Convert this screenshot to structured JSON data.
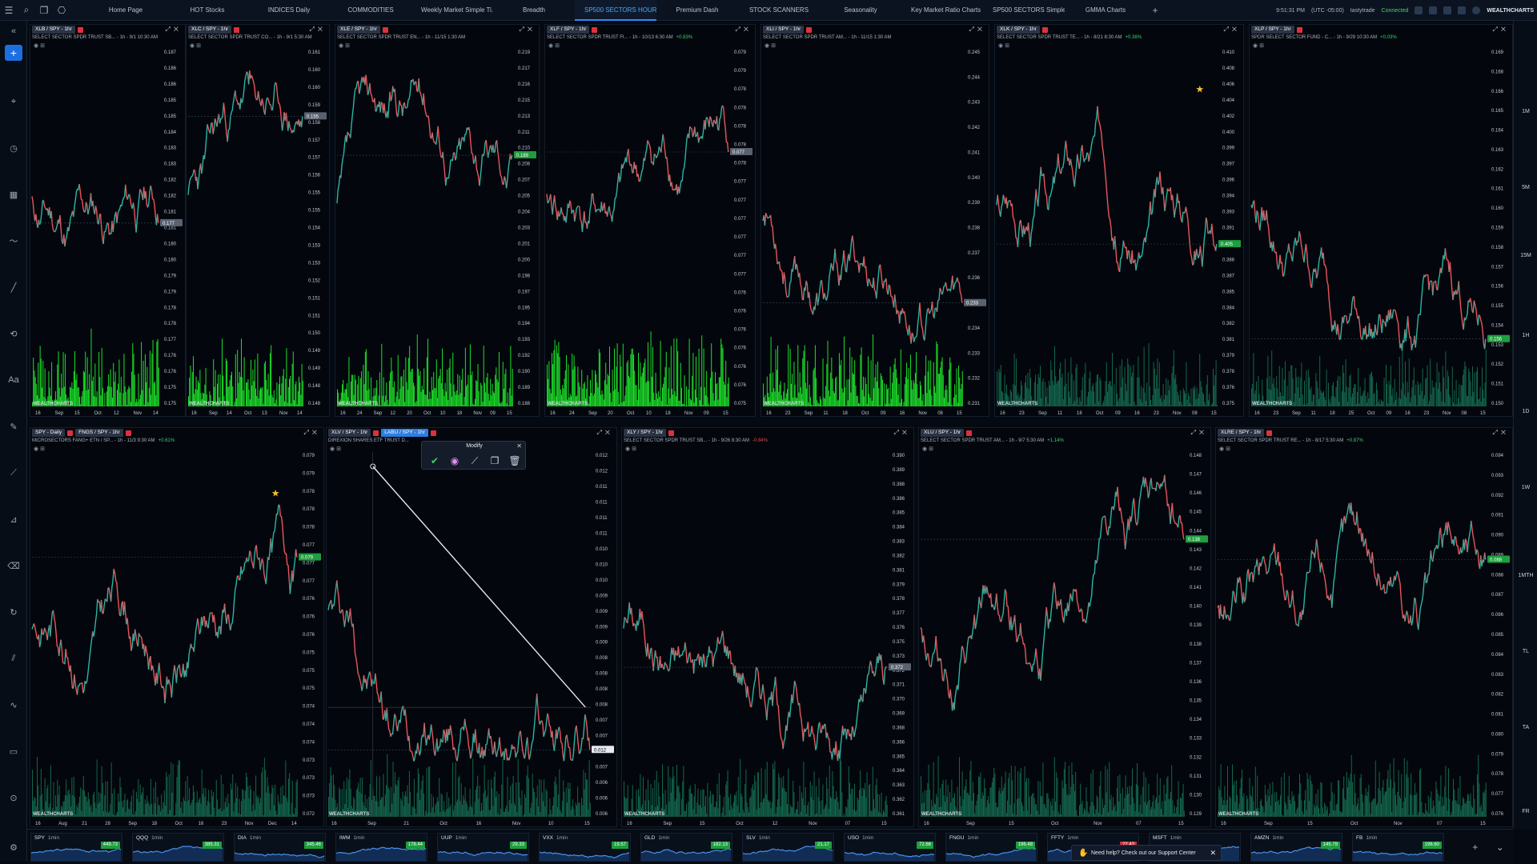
{
  "tabs": [
    "Home Page",
    "HOT Stocks",
    "INDICES Daily",
    "COMMODITIES",
    "Weekly Market Simple Ti...",
    "Breadth",
    "SP500 SECTORS HOURLY",
    "Premium Dash",
    "STOCK SCANNERS",
    "Seasonality",
    "Key Market Ratio Charts",
    "SP500 SECTORS Simple ...",
    "GMMA Charts"
  ],
  "active_tab": "SP500 SECTORS HOURLY",
  "topright": {
    "time": "9:51:31 PM",
    "tz": "(UTC -05:00)",
    "broker": "tastytrade",
    "status": "Connected",
    "brand": "WEALTHCHARTS"
  },
  "right_timeframes": [
    "1M",
    "5M",
    "15M",
    "1H",
    "1D",
    "1W",
    "1MTH",
    "TL",
    "TA",
    "FR"
  ],
  "modify": {
    "title": "Modify"
  },
  "panels": [
    {
      "id": "p1",
      "sym": "XLB / SPY - 1hr",
      "desc": "SELECT SECTOR SPDR TRUST SB... - 1h - 9/1 10:30 AM",
      "chg": "",
      "chgc": "",
      "ticks": [
        "0.187",
        "0.186",
        "0.186",
        "0.185",
        "0.185",
        "0.184",
        "0.183",
        "0.183",
        "0.182",
        "0.182",
        "0.181",
        "0.181",
        "0.180",
        "0.180",
        "0.179",
        "0.179",
        "0.178",
        "0.178",
        "0.177",
        "0.176",
        "0.176",
        "0.175",
        "0.175"
      ],
      "last": "0.177",
      "lastc": "#5a6270",
      "xt": [
        "16",
        "Sep",
        "15",
        "Oct",
        "12",
        "Nov",
        "14"
      ],
      "seed": 11,
      "trend": -0.3,
      "star": null
    },
    {
      "id": "p2",
      "sym": "XLC / SPY - 1hr",
      "desc": "SELECT SECTOR SPDR TRUST CO... - 1h - 9/1 5:30 AM",
      "chg": "",
      "chgc": "",
      "ticks": [
        "0.161",
        "0.160",
        "0.160",
        "0.159",
        "0.158",
        "0.157",
        "0.157",
        "0.156",
        "0.155",
        "0.155",
        "0.154",
        "0.153",
        "0.153",
        "0.152",
        "0.151",
        "0.151",
        "0.150",
        "0.149",
        "0.149",
        "0.148",
        "0.148"
      ],
      "last": "0.155",
      "lastc": "#5a6270",
      "xt": [
        "16",
        "Sep",
        "14",
        "Oct",
        "13",
        "Nov",
        "14"
      ],
      "seed": 23,
      "trend": 0.4,
      "star": null
    },
    {
      "id": "p3",
      "sym": "XLE / SPY - 1hr",
      "desc": "SELECT SECTOR SPDR TRUST EN... - 1h - 11/15 1:30 AM",
      "chg": "",
      "chgc": "",
      "ticks": [
        "0.219",
        "0.217",
        "0.216",
        "0.215",
        "0.213",
        "0.211",
        "0.210",
        "0.208",
        "0.207",
        "0.205",
        "0.204",
        "0.203",
        "0.201",
        "0.200",
        "0.198",
        "0.197",
        "0.195",
        "0.194",
        "0.193",
        "0.192",
        "0.190",
        "0.189",
        "0.188"
      ],
      "last": "0.189",
      "lastc": "#1e9e3e",
      "xt": [
        "16",
        "24",
        "Sep",
        "12",
        "20",
        "Oct",
        "10",
        "18",
        "Nov",
        "09",
        "15"
      ],
      "seed": 37,
      "trend": 0.1,
      "star": null
    },
    {
      "id": "p4",
      "sym": "XLF / SPY - 1hr",
      "desc": "SELECT SECTOR SPDR TRUST FI... - 1h - 10/13 6:30 AM",
      "chg": "+0.83%",
      "chgc": "g",
      "ticks": [
        "0.079",
        "0.079",
        "0.078",
        "0.078",
        "0.078",
        "0.078",
        "0.078",
        "0.077",
        "0.077",
        "0.077",
        "0.077",
        "0.077",
        "0.077",
        "0.076",
        "0.076",
        "0.076",
        "0.076",
        "0.076",
        "0.076",
        "0.075"
      ],
      "last": "0.077",
      "lastc": "#5a6270",
      "xt": [
        "16",
        "24",
        "Sep",
        "20",
        "Oct",
        "10",
        "18",
        "Nov",
        "09",
        "15"
      ],
      "seed": 41,
      "trend": 0.0,
      "star": null
    },
    {
      "id": "p5",
      "sym": "XLI / SPY - 1hr",
      "desc": "SELECT SECTOR SPDR TRUST AM... - 1h - 11/15 1:30 AM",
      "chg": "",
      "chgc": "",
      "ticks": [
        "0.245",
        "0.244",
        "0.243",
        "0.242",
        "0.241",
        "0.240",
        "0.239",
        "0.238",
        "0.237",
        "0.236",
        "0.235",
        "0.234",
        "0.233",
        "0.232",
        "0.231"
      ],
      "last": "0.233",
      "lastc": "#5a6270",
      "xt": [
        "16",
        "23",
        "Sep",
        "11",
        "18",
        "Oct",
        "09",
        "16",
        "Nov",
        "08",
        "15"
      ],
      "seed": 53,
      "trend": -0.35,
      "star": null
    },
    {
      "id": "p6",
      "sym": "XLK / SPY - 1hr",
      "desc": "SELECT SECTOR SPDR TRUST TE... - 1h - 8/21 8:30 AM",
      "chg": "+0.38%",
      "chgc": "g",
      "ticks": [
        "0.410",
        "0.408",
        "0.406",
        "0.404",
        "0.402",
        "0.400",
        "0.399",
        "0.397",
        "0.396",
        "0.394",
        "0.393",
        "0.391",
        "0.390",
        "0.388",
        "0.387",
        "0.385",
        "0.384",
        "0.382",
        "0.381",
        "0.379",
        "0.378",
        "0.376",
        "0.375"
      ],
      "last": "0.405",
      "lastc": "#1e9e3e",
      "xt": [
        "16",
        "23",
        "Sep",
        "11",
        "18",
        "Oct",
        "09",
        "16",
        "23",
        "Nov",
        "08",
        "15"
      ],
      "seed": 67,
      "trend": 0.55,
      "star": [
        0.9,
        0.1
      ]
    },
    {
      "id": "p7",
      "sym": "XLP / SPY - 1hr",
      "desc": "SPDR SELECT SECTOR FUND - C... - 1h - 9/29 10:30 AM",
      "chg": "+0.03%",
      "chgc": "g",
      "ticks": [
        "0.169",
        "0.168",
        "0.166",
        "0.165",
        "0.164",
        "0.163",
        "0.162",
        "0.161",
        "0.160",
        "0.159",
        "0.158",
        "0.157",
        "0.156",
        "0.155",
        "0.154",
        "0.153",
        "0.152",
        "0.151",
        "0.150"
      ],
      "last": "0.156",
      "lastc": "#1e9e3e",
      "xt": [
        "16",
        "23",
        "Sep",
        "11",
        "18",
        "25",
        "Oct",
        "09",
        "16",
        "23",
        "Nov",
        "08",
        "15"
      ],
      "seed": 79,
      "trend": -0.4,
      "star": null
    },
    {
      "id": "p8",
      "sym": "SPY - Daily",
      "sym2": "FNGS / SPY - 1hr",
      "desc": "MICROSECTORS FANG+ ETN / SP... - 1h - 11/3 9:30 AM",
      "chg": "+0.61%",
      "chgc": "g",
      "ticks": [
        "0.079",
        "0.079",
        "0.078",
        "0.078",
        "0.078",
        "0.077",
        "0.077",
        "0.077",
        "0.076",
        "0.076",
        "0.076",
        "0.075",
        "0.075",
        "0.075",
        "0.074",
        "0.074",
        "0.074",
        "0.073",
        "0.073",
        "0.073",
        "0.072"
      ],
      "last": "0.079",
      "lastc": "#1e9e3e",
      "xt": [
        "16",
        "Aug",
        "21",
        "28",
        "Sep",
        "18",
        "Oct",
        "16",
        "23",
        "Nov",
        "Dec",
        "14"
      ],
      "seed": 83,
      "trend": 0.6,
      "star": [
        0.9,
        0.1
      ]
    },
    {
      "id": "p9",
      "sym": "XLV / SPY - 1hr",
      "sym2": "LABU / SPY - 1hr",
      "desc": "DIREXION SHARES ETF TRUST D...",
      "chg": "",
      "chgc": "",
      "ticks": [
        "0.012",
        "0.012",
        "0.011",
        "0.011",
        "0.011",
        "0.011",
        "0.010",
        "0.010",
        "0.010",
        "0.009",
        "0.009",
        "0.009",
        "0.009",
        "0.008",
        "0.008",
        "0.008",
        "0.008",
        "0.007",
        "0.007",
        "0.007",
        "0.007",
        "0.006",
        "0.006",
        "0.006"
      ],
      "last": "0.012",
      "lastc": "#e6eaf0",
      "xt": [
        "16",
        "Sep",
        "21",
        "Oct",
        "16",
        "Nov",
        "10",
        "15"
      ],
      "seed": 97,
      "trend": -0.7,
      "star": null,
      "trendline": true
    },
    {
      "id": "p10",
      "sym": "XLY / SPY - 1hr",
      "desc": "SELECT SECTOR SPDR TRUST SB... - 1h - 9/26 8:30 AM",
      "chg": "-0.84%",
      "chgc": "r",
      "ticks": [
        "0.390",
        "0.389",
        "0.388",
        "0.386",
        "0.385",
        "0.384",
        "0.383",
        "0.382",
        "0.381",
        "0.379",
        "0.378",
        "0.377",
        "0.376",
        "0.375",
        "0.373",
        "0.372",
        "0.371",
        "0.370",
        "0.369",
        "0.368",
        "0.366",
        "0.365",
        "0.364",
        "0.363",
        "0.362",
        "0.361"
      ],
      "last": "0.372",
      "lastc": "#5a6270",
      "xt": [
        "16",
        "Sep",
        "15",
        "Oct",
        "12",
        "Nov",
        "07",
        "15"
      ],
      "seed": 101,
      "trend": -0.1,
      "star": null
    },
    {
      "id": "p11",
      "sym": "XLU / SPY - 1hr",
      "desc": "SELECT SECTOR SPDR TRUST AM... - 1h - 9/7 5:30 AM",
      "chg": "+1.14%",
      "chgc": "g",
      "ticks": [
        "0.148",
        "0.147",
        "0.146",
        "0.145",
        "0.144",
        "0.143",
        "0.142",
        "0.141",
        "0.140",
        "0.139",
        "0.138",
        "0.137",
        "0.136",
        "0.135",
        "0.134",
        "0.133",
        "0.132",
        "0.131",
        "0.130",
        "0.129"
      ],
      "last": "0.138",
      "lastc": "#1e9e3e",
      "xt": [
        "16",
        "Sep",
        "15",
        "Oct",
        "Nov",
        "07",
        "15"
      ],
      "seed": 113,
      "trend": -0.05,
      "star": null
    },
    {
      "id": "p12",
      "sym": "XLRE / SPY - 1hr",
      "desc": "SELECT SECTOR SPDR TRUST RE... - 1h - 8/17 5:30 AM",
      "chg": "+0.87%",
      "chgc": "g",
      "ticks": [
        "0.094",
        "0.093",
        "0.092",
        "0.091",
        "0.090",
        "0.089",
        "0.088",
        "0.087",
        "0.086",
        "0.085",
        "0.084",
        "0.083",
        "0.082",
        "0.081",
        "0.080",
        "0.079",
        "0.078",
        "0.077",
        "0.076"
      ],
      "last": "0.088",
      "lastc": "#1e9e3e",
      "xt": [
        "16",
        "Sep",
        "15",
        "Oct",
        "Nov",
        "07",
        "15"
      ],
      "seed": 127,
      "trend": -0.2,
      "star": null
    }
  ],
  "minis": [
    {
      "sym": "SPY",
      "tf": "1min",
      "price": "449.73",
      "c": "g",
      "seed": 3
    },
    {
      "sym": "QQQ",
      "tf": "1min",
      "price": "385.31",
      "c": "g",
      "seed": 5
    },
    {
      "sym": "DIA",
      "tf": "1min",
      "price": "345.46",
      "c": "g",
      "seed": 7
    },
    {
      "sym": "IWM",
      "tf": "1min",
      "price": "178.44",
      "c": "g",
      "seed": 9
    },
    {
      "sym": "UUP",
      "tf": "1min",
      "price": "29.33",
      "c": "g",
      "seed": 13
    },
    {
      "sym": "VXX",
      "tf": "1min",
      "price": "19.57",
      "c": "g",
      "seed": 17
    },
    {
      "sym": "GLD",
      "tf": "1min",
      "price": "182.13",
      "c": "g",
      "seed": 19
    },
    {
      "sym": "SLV",
      "tf": "1min",
      "price": "21.17",
      "c": "g",
      "seed": 21
    },
    {
      "sym": "USO",
      "tf": "1min",
      "price": "72.66",
      "c": "g",
      "seed": 25
    },
    {
      "sym": "FNGU",
      "tf": "1min",
      "price": "196.48",
      "c": "g",
      "seed": 27
    },
    {
      "sym": "FFTY",
      "tf": "1min",
      "price": "22.43",
      "c": "r",
      "seed": 29
    },
    {
      "sym": "MSFT",
      "tf": "1min",
      "price": "",
      "c": "g",
      "seed": 31
    },
    {
      "sym": "AMZN",
      "tf": "1min",
      "price": "145.79",
      "c": "g",
      "seed": 33
    },
    {
      "sym": "FB",
      "tf": "1min",
      "price": "196.60",
      "c": "g",
      "seed": 35
    }
  ],
  "support": {
    "text": "Need help? Check out our Support Center"
  },
  "logo_text": "WEALTHCHARTS",
  "colors": {
    "up": "#2bb5a3",
    "down": "#e8555c",
    "vol": "#1eea2a",
    "accent": "#2e8cff"
  }
}
